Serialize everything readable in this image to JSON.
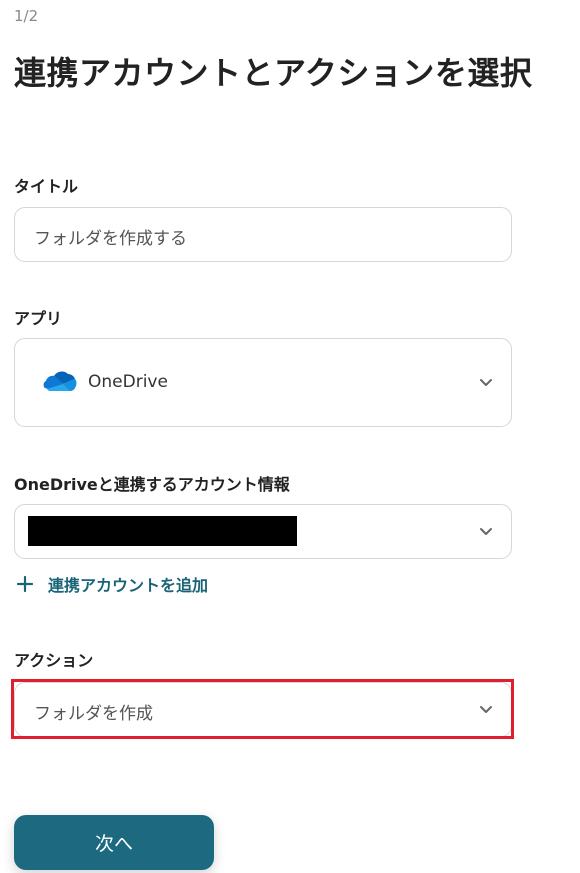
{
  "step": "1/2",
  "title": "連携アカウントとアクションを選択",
  "fields": {
    "title": {
      "label": "タイトル",
      "value": "フォルダを作成する"
    },
    "app": {
      "label": "アプリ",
      "value": "OneDrive",
      "icon": "onedrive-cloud-icon"
    },
    "account": {
      "label": "OneDriveと連携するアカウント情報",
      "value": ""
    },
    "action": {
      "label": "アクション",
      "value": "フォルダを作成"
    }
  },
  "add_account_label": "連携アカウントを追加",
  "next_label": "次へ",
  "colors": {
    "accent": "#1d6a80",
    "link": "#1a6478",
    "highlight": "#e01e2d",
    "onedrive": "#0364b8"
  }
}
